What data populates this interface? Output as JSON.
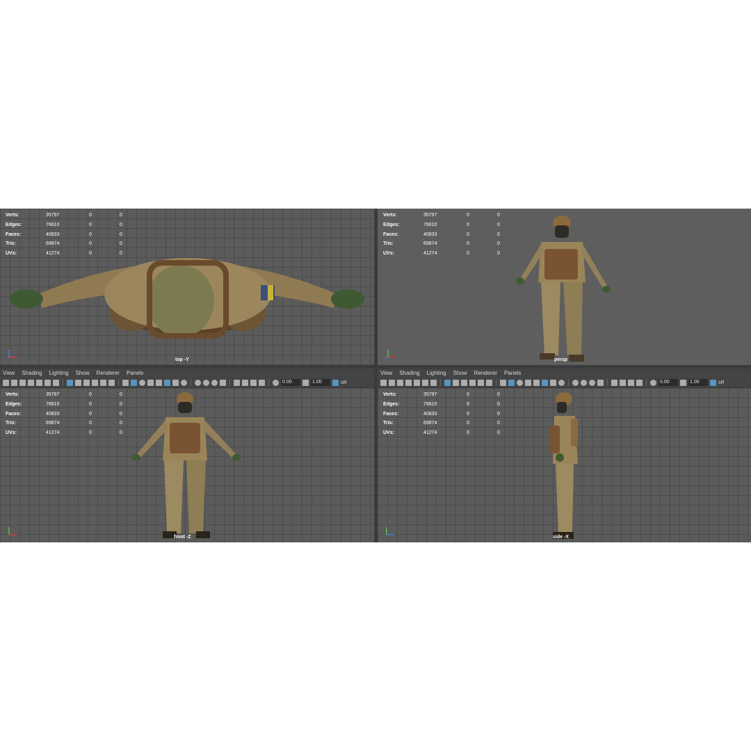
{
  "menu": [
    "View",
    "Shading",
    "Lighting",
    "Show",
    "Renderer",
    "Panels"
  ],
  "toolbar": {
    "exposure": "0.00",
    "gamma": "1.00",
    "colorspace_abbrev": "sR"
  },
  "stats": {
    "labels": [
      "Verts:",
      "Edges:",
      "Faces:",
      "Tris:",
      "UVs:"
    ],
    "values": [
      "35797",
      "76610",
      "40833",
      "69874",
      "41274"
    ],
    "col2": [
      "0",
      "0",
      "0",
      "0",
      "0"
    ],
    "col3": [
      "0",
      "0",
      "0",
      "0",
      "0"
    ]
  },
  "viewports": {
    "top": "top -Y",
    "persp": "persp",
    "front": "front -Z",
    "side": "side -X"
  },
  "colors": {
    "viewport_bg": "#5b5b5b",
    "grid_line": "#4c4c4c",
    "ui_bar": "#444444",
    "active_icon": "#5aa2d6",
    "axis_x": "#d23c3c",
    "axis_y": "#4cc24c",
    "axis_z": "#4a7ee0"
  },
  "icons": [
    "camera-icon",
    "select-icon",
    "lasso-icon",
    "bookmark-icon",
    "grid-icon",
    "wireframe-icon",
    "smooth-shade-icon",
    "texture-icon",
    "light-icon",
    "shadow-icon",
    "isolate-icon",
    "xray-icon",
    "exposure-icon",
    "gamma-icon"
  ]
}
